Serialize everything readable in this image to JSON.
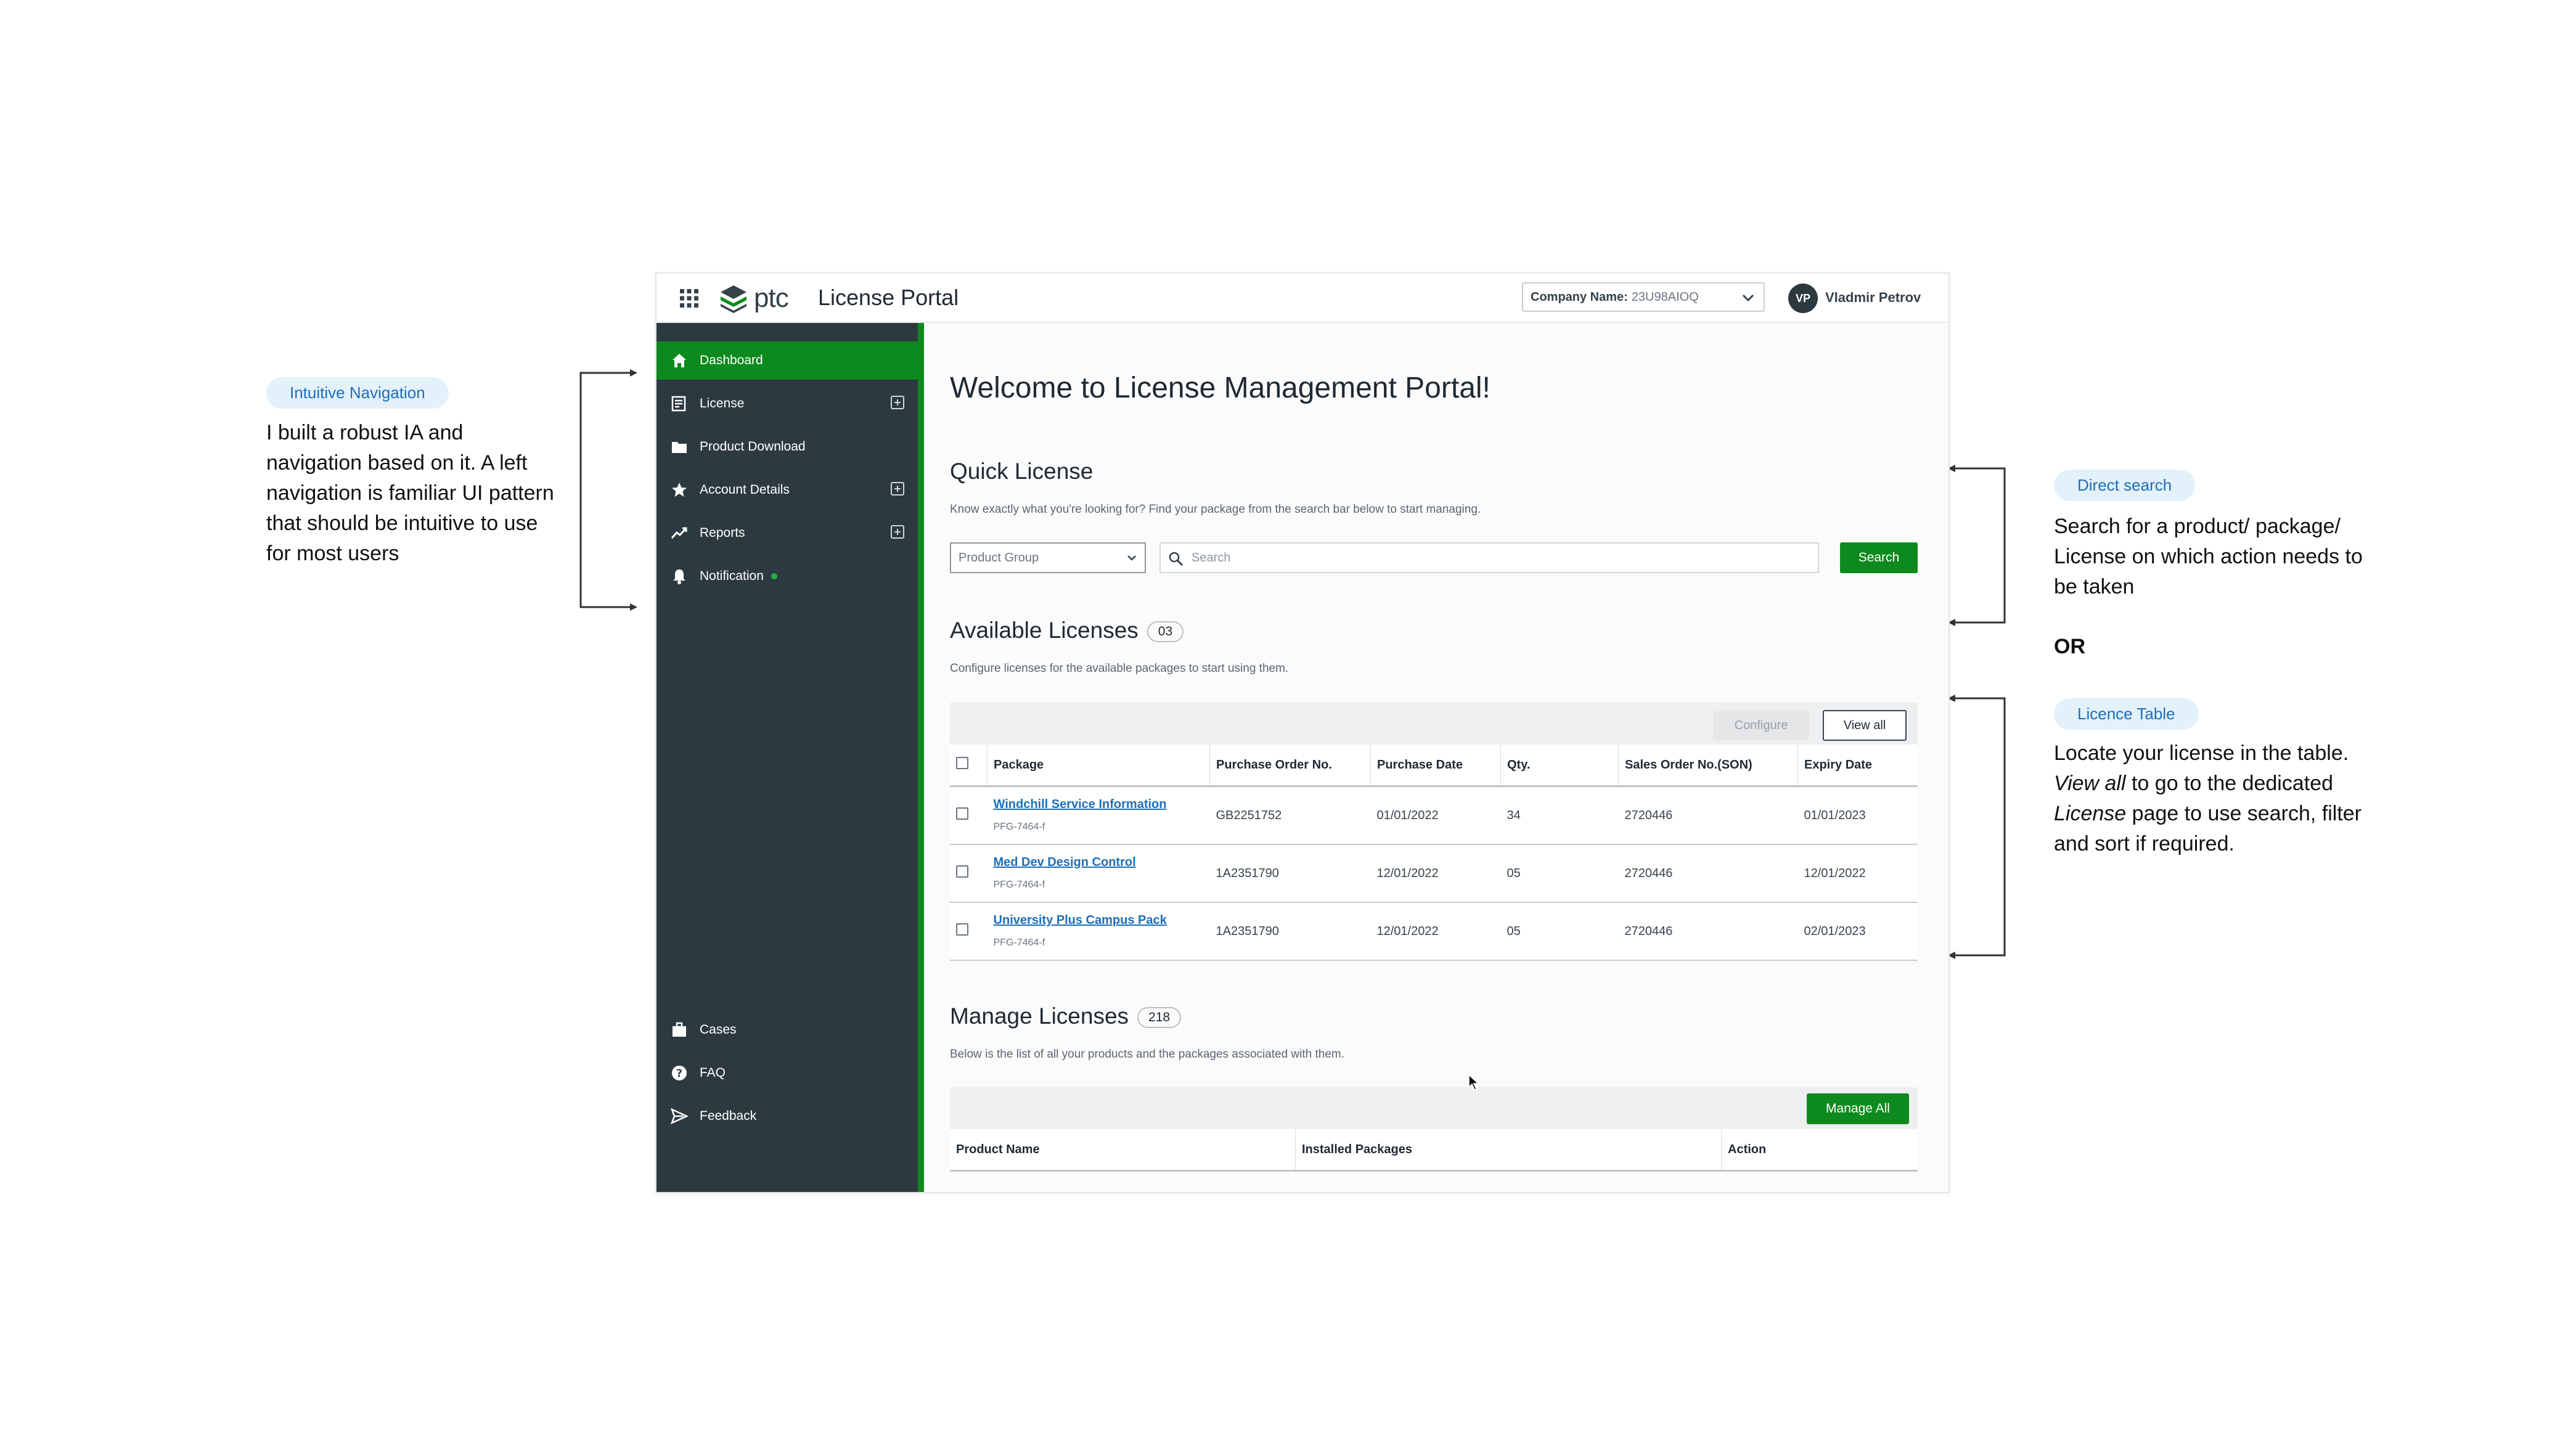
{
  "annotations": {
    "nav_pill": "Intuitive Navigation",
    "nav_text": "I built a robust IA and navigation based on it. A left navigation is familiar UI pattern that should be intuitive to use for most users",
    "search_pill": "Direct search",
    "search_text": "Search for a product/ package/ License on which action needs to be taken",
    "or_label": "OR",
    "table_pill": "Licence Table",
    "table_text_1": "Locate your license in the table.",
    "table_text_em1": "View all",
    "table_text_2": "to go to the dedicated",
    "table_text_em2": "License",
    "table_text_3": "page to use search, filter and sort if required."
  },
  "header": {
    "logo_text": "ptc",
    "title": "License Portal",
    "company_label": "Company Name:",
    "company_value": "23U98AIOQ",
    "avatar_initials": "VP",
    "user_name": "Vladmir Petrov"
  },
  "sidebar": {
    "items": [
      {
        "label": "Dashboard",
        "icon": "home-icon"
      },
      {
        "label": "License",
        "icon": "license-icon"
      },
      {
        "label": "Product Download",
        "icon": "folder-icon"
      },
      {
        "label": "Account Details",
        "icon": "star-icon"
      },
      {
        "label": "Reports",
        "icon": "trend-icon"
      },
      {
        "label": "Notification",
        "icon": "bell-icon"
      }
    ],
    "bottom_items": [
      {
        "label": "Cases",
        "icon": "briefcase-icon"
      },
      {
        "label": "FAQ",
        "icon": "question-icon"
      },
      {
        "label": "Feedback",
        "icon": "send-icon"
      }
    ]
  },
  "main": {
    "welcome": "Welcome to License Management Portal!",
    "quick": {
      "title": "Quick License",
      "subtitle": "Know exactly what you're looking for? Find your package from the search bar below to start managing.",
      "select_value": "Product Group",
      "search_placeholder": "Search",
      "search_button": "Search"
    },
    "available": {
      "title": "Available Licenses",
      "count": "03",
      "subtitle": "Configure licenses for the available packages to start using them.",
      "configure_button": "Configure",
      "view_all_button": "View all",
      "columns": [
        "Package",
        "Purchase Order No.",
        "Purchase Date",
        "Qty.",
        "Sales Order No.(SON)",
        "Expiry Date"
      ],
      "rows": [
        {
          "name": "Windchill Service Information",
          "code": "PFG-7464-f",
          "po": "GB2251752",
          "date": "01/01/2022",
          "qty": "34",
          "son": "2720446",
          "expiry": "01/01/2023"
        },
        {
          "name": "Med Dev Design Control",
          "code": "PFG-7464-f",
          "po": "1A2351790",
          "date": "12/01/2022",
          "qty": "05",
          "son": "2720446",
          "expiry": "12/01/2022"
        },
        {
          "name": "University Plus Campus Pack",
          "code": "PFG-7464-f",
          "po": "1A2351790",
          "date": "12/01/2022",
          "qty": "05",
          "son": "2720446",
          "expiry": "02/01/2023"
        }
      ]
    },
    "manage": {
      "title": "Manage Licenses",
      "count": "218",
      "subtitle": "Below is the list of all your products and the packages associated with them.",
      "manage_all_button": "Manage All",
      "columns": [
        "Product Name",
        "Installed Packages",
        "Action"
      ]
    }
  },
  "colors": {
    "brand_green": "#0d8a1d",
    "sidebar_bg": "#2d3940",
    "link_blue": "#1d6fb8",
    "pill_bg": "#e3f1fb"
  }
}
